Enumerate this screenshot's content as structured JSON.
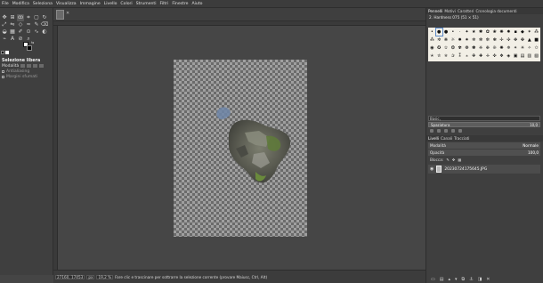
{
  "menubar": {
    "items": [
      "File",
      "Modifica",
      "Seleziona",
      "Visualizza",
      "Immagine",
      "Livello",
      "Colori",
      "Strumenti",
      "Filtri",
      "Finestre",
      "Aiuto"
    ]
  },
  "image_tab": {
    "close": "✕"
  },
  "toolbox": {
    "tools": [
      {
        "icon": "move-icon",
        "glyph": "✥"
      },
      {
        "icon": "align-icon",
        "glyph": "⊞"
      },
      {
        "icon": "free-select-icon",
        "glyph": "ꝏ",
        "active": true
      },
      {
        "icon": "crop-icon",
        "glyph": "⌗"
      },
      {
        "icon": "rect-select-icon",
        "glyph": "▢"
      },
      {
        "icon": "rotate-icon",
        "glyph": "↻"
      },
      {
        "icon": "scale-icon",
        "glyph": "⤢"
      },
      {
        "icon": "flip-icon",
        "glyph": "⇋"
      },
      {
        "icon": "perspective-icon",
        "glyph": "◇"
      },
      {
        "icon": "warp-icon",
        "glyph": "≈"
      },
      {
        "icon": "paint-icon",
        "glyph": "✎"
      },
      {
        "icon": "eraser-icon",
        "glyph": "⌫"
      },
      {
        "icon": "bucket-icon",
        "glyph": "◒"
      },
      {
        "icon": "gradient-icon",
        "glyph": "▦"
      },
      {
        "icon": "pencil-icon",
        "glyph": "✐"
      },
      {
        "icon": "clone-icon",
        "glyph": "⊙"
      },
      {
        "icon": "smudge-icon",
        "glyph": "∿"
      },
      {
        "icon": "dodge-icon",
        "glyph": "◐"
      },
      {
        "icon": "path-icon",
        "glyph": "⌁"
      },
      {
        "icon": "text-icon",
        "glyph": "A"
      },
      {
        "icon": "picker-icon",
        "glyph": "⊘"
      },
      {
        "icon": "zoom-icon",
        "glyph": "⌕"
      }
    ],
    "swap_colors": "⇆",
    "options": {
      "title": "Selezione libera",
      "mode_label": "Modalità",
      "antialias_label": "Antialiasing",
      "feather_label": "Margini sfumati"
    }
  },
  "status": {
    "coords": "27160, 17453",
    "unit": "px",
    "zoom": "19,2 %",
    "message": "Fare clic e trascinare per sottrarre la selezione corrente (provare Maiusc, Ctrl, Alt)"
  },
  "right": {
    "top_tabs": [
      "Pennelli",
      "Motivi",
      "Caratteri",
      "Cronologia documenti"
    ],
    "brush_name": "2. Hardness 075 (51 × 51)",
    "brushes": [
      "•",
      "●",
      "●",
      "•",
      "·",
      "✦",
      "★",
      "✱",
      "✿",
      "❀",
      "✺",
      "✸",
      "▪",
      "◆",
      "✶",
      "⁂",
      "⁂",
      "✲",
      "❋",
      "☼",
      "✹",
      "✷",
      "❄",
      "✻",
      "✼",
      "❃",
      "✢",
      "✣",
      "✥",
      "✤",
      "▲",
      "■",
      "◉",
      "✪",
      "✫",
      "❂",
      "✾",
      "❁",
      "✽",
      "❈",
      "❉",
      "❊",
      "✺",
      "✵",
      "✴",
      "✳",
      "✧",
      "✩",
      "✭",
      "✮",
      "✯",
      "✰",
      "⁑",
      "⁎",
      "✙",
      "✚",
      "✛",
      "✜",
      "❖",
      "◈",
      "▣",
      "▤",
      "▥",
      "▧"
    ],
    "filter_text": "Basic,",
    "spacing_label": "Spaziatura",
    "spacing_value": "10,0",
    "layer_tabs": [
      "Livelli",
      "Canali",
      "Tracciati"
    ],
    "mode_label": "Modalità",
    "mode_value": "Normale",
    "opacity_label": "Opacità",
    "opacity_value": "100,0",
    "lock_label": "Blocca:",
    "layer_name": "20230724175645.JPG"
  }
}
